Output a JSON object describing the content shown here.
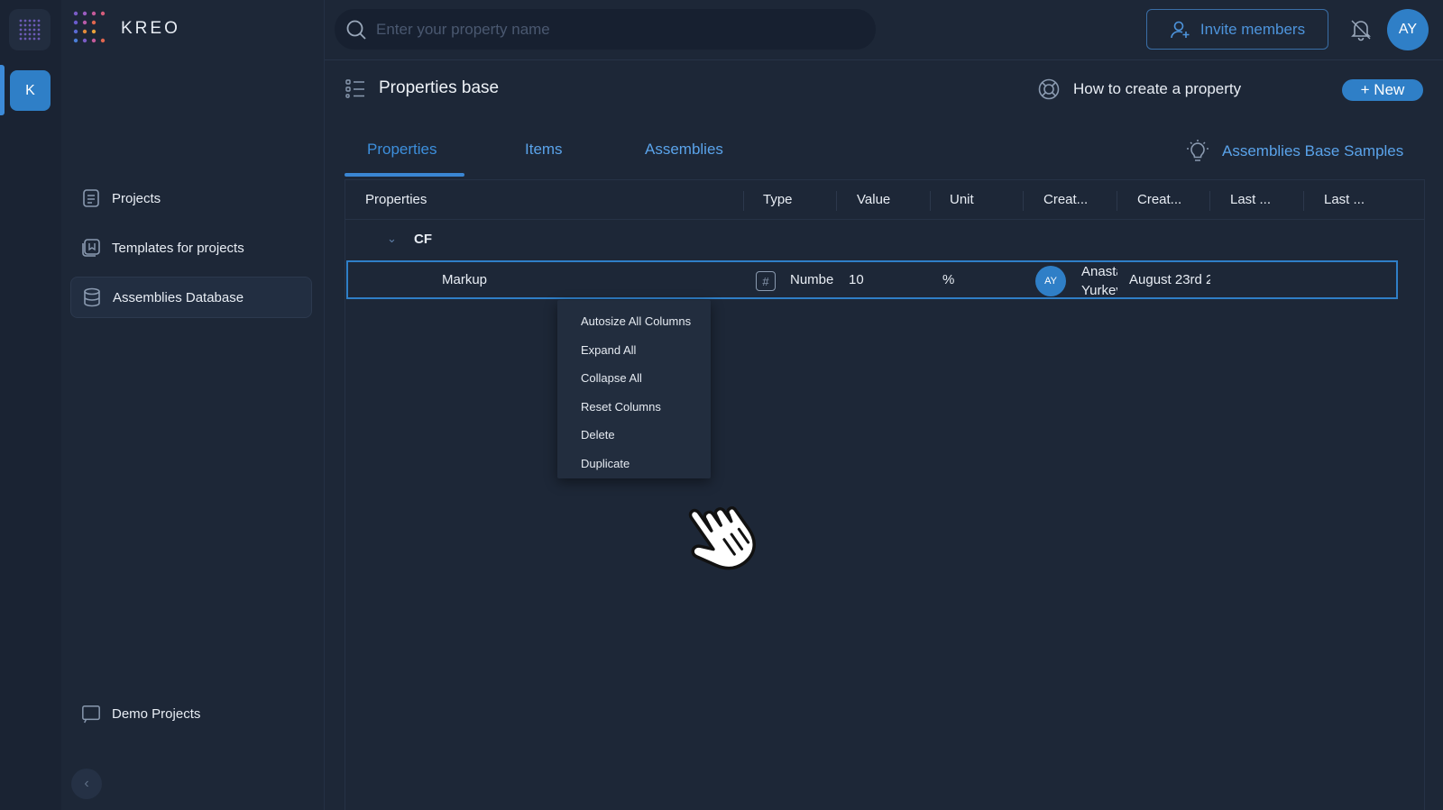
{
  "workspace": {
    "initial": "K"
  },
  "brand": {
    "name": "KREO"
  },
  "sidebar": {
    "items": [
      {
        "label": "Projects",
        "icon": "projects-icon"
      },
      {
        "label": "Templates for projects",
        "icon": "templates-icon"
      },
      {
        "label": "Assemblies Database",
        "icon": "database-icon",
        "active": true
      }
    ],
    "footer_item": {
      "label": "Demo Projects",
      "icon": "demo-icon"
    }
  },
  "topbar": {
    "search_placeholder": "Enter your property name",
    "invite_label": "Invite members",
    "user_initials": "AY"
  },
  "main": {
    "title": "Properties base",
    "help_label": "How to create a property",
    "new_label": "+ New",
    "tabs": [
      {
        "label": "Properties",
        "active": true
      },
      {
        "label": "Items"
      },
      {
        "label": "Assemblies"
      }
    ],
    "samples_label": "Assemblies Base Samples"
  },
  "grid": {
    "columns": [
      "Properties",
      "Type",
      "Value",
      "Unit",
      "Creat...",
      "Creat...",
      "Last ...",
      "Last ..."
    ],
    "group": {
      "name": "CF"
    },
    "row": {
      "name": "Markup",
      "type": "Numbe",
      "value": "10",
      "unit": "%",
      "creator_initials": "AY",
      "creator_line1": "Anastasia",
      "creator_line2": "Yurkevich",
      "created_date": "August 23rd 2"
    }
  },
  "context_menu": {
    "items": [
      "Autosize All Columns",
      "Expand All",
      "Collapse All",
      "Reset Columns",
      "Delete",
      "Duplicate"
    ]
  },
  "colors": {
    "accent": "#2f7fc7",
    "link": "#5aa3ea",
    "background": "#1d2737"
  }
}
